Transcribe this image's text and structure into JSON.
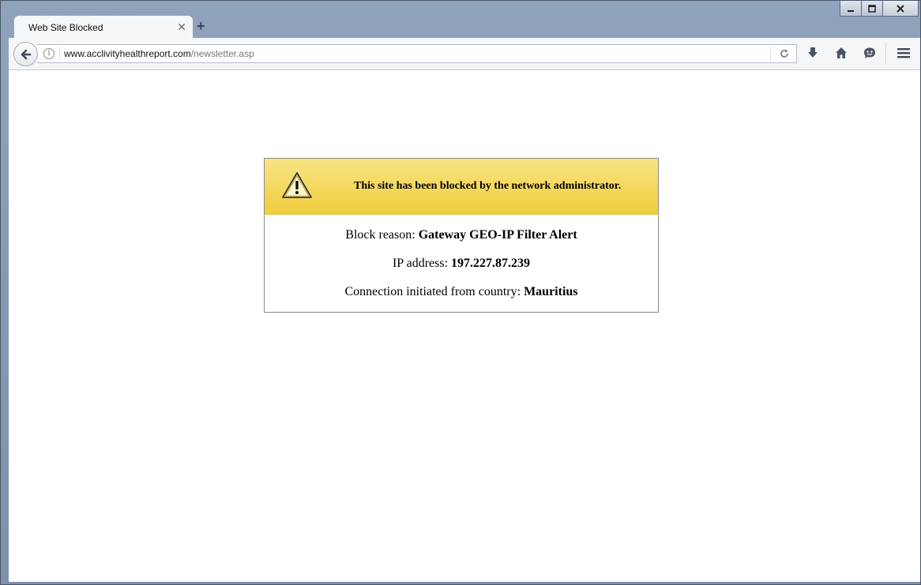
{
  "window": {
    "controls": [
      "minimize",
      "maximize",
      "close"
    ]
  },
  "tab": {
    "title": "Web Site Blocked",
    "close_icon": "close-icon",
    "new_tab_icon": "plus-icon"
  },
  "navbar": {
    "url_domain": "www.acclivityhealthreport.com",
    "url_path": "/newsletter.asp",
    "icons": [
      "back-arrow-icon",
      "info-icon",
      "reload-icon",
      "download-icon",
      "home-icon",
      "hello-icon",
      "hamburger-menu-icon"
    ]
  },
  "block_page": {
    "title": "This site has been blocked by the network administrator.",
    "reason_label": "Block reason: ",
    "reason_value": "Gateway GEO-IP Filter Alert",
    "ip_label": "IP address: ",
    "ip_value": "197.227.87.239",
    "country_label": "Connection initiated from country: ",
    "country_value": "Mauritius",
    "header_color": "#f3d44f"
  }
}
